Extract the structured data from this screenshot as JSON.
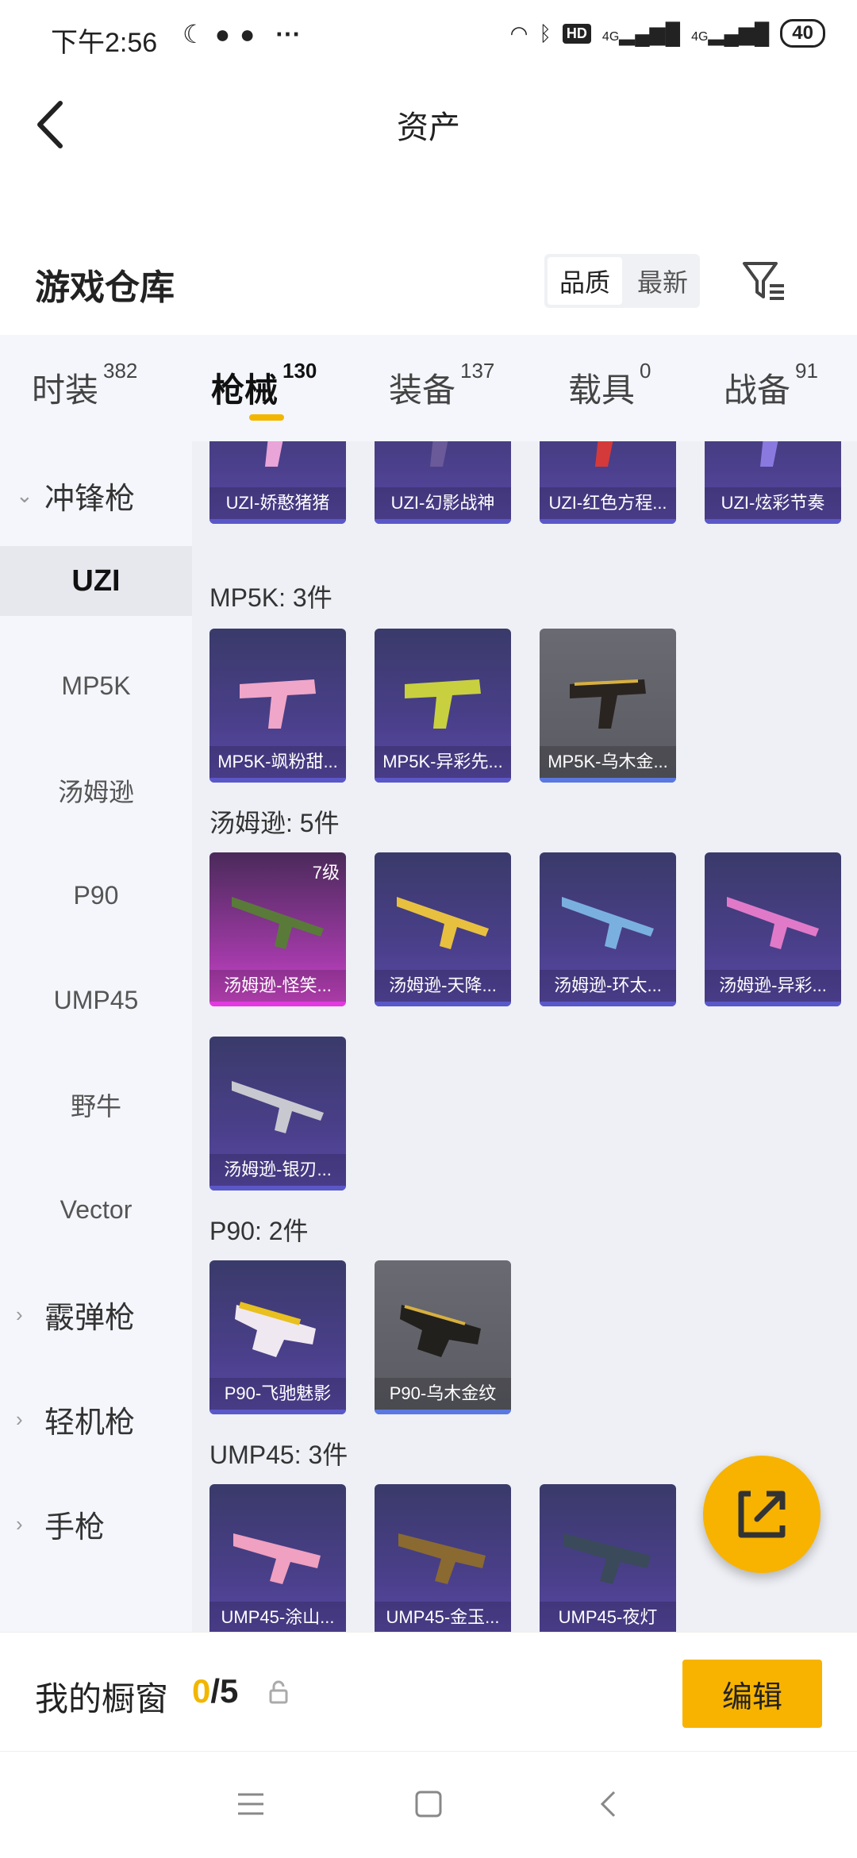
{
  "status_bar": {
    "time": "下午2:56",
    "more": "···",
    "battery": "40",
    "network1": "4G",
    "network2": "4G",
    "hd": "HD"
  },
  "header": {
    "title": "资产"
  },
  "section": {
    "title": "游戏仓库",
    "sort_options": [
      "品质",
      "最新"
    ]
  },
  "tabs": [
    {
      "label": "时装",
      "count": "382"
    },
    {
      "label": "枪械",
      "count": "130"
    },
    {
      "label": "装备",
      "count": "137"
    },
    {
      "label": "载具",
      "count": "0"
    },
    {
      "label": "战备",
      "count": "91"
    }
  ],
  "sidebar": {
    "items": [
      {
        "label": "冲锋枪",
        "type": "group",
        "expanded": true
      },
      {
        "label": "UZI",
        "type": "sub",
        "selected": true
      },
      {
        "label": "MP5K",
        "type": "sub"
      },
      {
        "label": "汤姆逊",
        "type": "sub"
      },
      {
        "label": "P90",
        "type": "sub"
      },
      {
        "label": "UMP45",
        "type": "sub"
      },
      {
        "label": "野牛",
        "type": "sub"
      },
      {
        "label": "Vector",
        "type": "sub"
      },
      {
        "label": "霰弹枪",
        "type": "group"
      },
      {
        "label": "轻机枪",
        "type": "group"
      },
      {
        "label": "手枪",
        "type": "group"
      }
    ]
  },
  "groups": [
    {
      "label": "",
      "items": [
        "UZI-娇憨猪猪",
        "UZI-幻影战神",
        "UZI-红色方程...",
        "UZI-炫彩节奏"
      ]
    },
    {
      "label": "MP5K: 3件",
      "items": [
        "MP5K-飒粉甜...",
        "MP5K-异彩先...",
        "MP5K-乌木金..."
      ]
    },
    {
      "label": "汤姆逊: 5件",
      "items": [
        "汤姆逊-怪笑...",
        "汤姆逊-天降...",
        "汤姆逊-环太...",
        "汤姆逊-异彩...",
        "汤姆逊-银刃..."
      ],
      "level_badge": "7级"
    },
    {
      "label": "P90: 2件",
      "items": [
        "P90-飞驰魅影",
        "P90-乌木金纹"
      ]
    },
    {
      "label": "UMP45: 3件",
      "items": [
        "UMP45-涂山...",
        "UMP45-金玉...",
        "UMP45-夜灯"
      ]
    }
  ],
  "bottom": {
    "showcase_label": "我的橱窗",
    "count_current": "0",
    "count_total": "/5",
    "edit_label": "编辑"
  },
  "colors": {
    "accent": "#f7b300",
    "card_purple": "#4a3f8a",
    "card_pink": "#d64ad0",
    "card_gray": "#5a5a62"
  }
}
